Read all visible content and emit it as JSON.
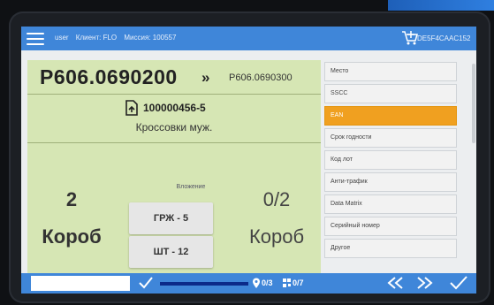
{
  "header": {
    "user": "user",
    "client": "Клиент: FLO",
    "mission": "Миссия: 100557",
    "device_id": "DE5F4CAAC152"
  },
  "item": {
    "code": "P606.0690200",
    "next_code": "P606.0690300",
    "doc_number": "100000456-5",
    "product_name": "Кроссовки муж."
  },
  "quantities": {
    "left_value": "2",
    "left_unit": "Короб",
    "right_value": "0/2",
    "right_unit": "Короб",
    "placement_label": "Вложение"
  },
  "locations": [
    "ГРЖ - 5",
    "ШТ - 12"
  ],
  "right_menu": [
    {
      "label": "Место",
      "active": false
    },
    {
      "label": "SSCC",
      "active": false
    },
    {
      "label": "EAN",
      "active": true
    },
    {
      "label": "Срок годности",
      "active": false
    },
    {
      "label": "Код лот",
      "active": false
    },
    {
      "label": "Анти-трафик",
      "active": false
    },
    {
      "label": "Data Matrix",
      "active": false
    },
    {
      "label": "Серийный номер",
      "active": false
    },
    {
      "label": "Другое",
      "active": false
    }
  ],
  "footer": {
    "input_value": "",
    "count_locations": "0/3",
    "count_codes": "0/7"
  },
  "colors": {
    "header_blue": "#3f86d9",
    "panel_green": "#d6e6b4",
    "active_orange": "#f0a020"
  }
}
